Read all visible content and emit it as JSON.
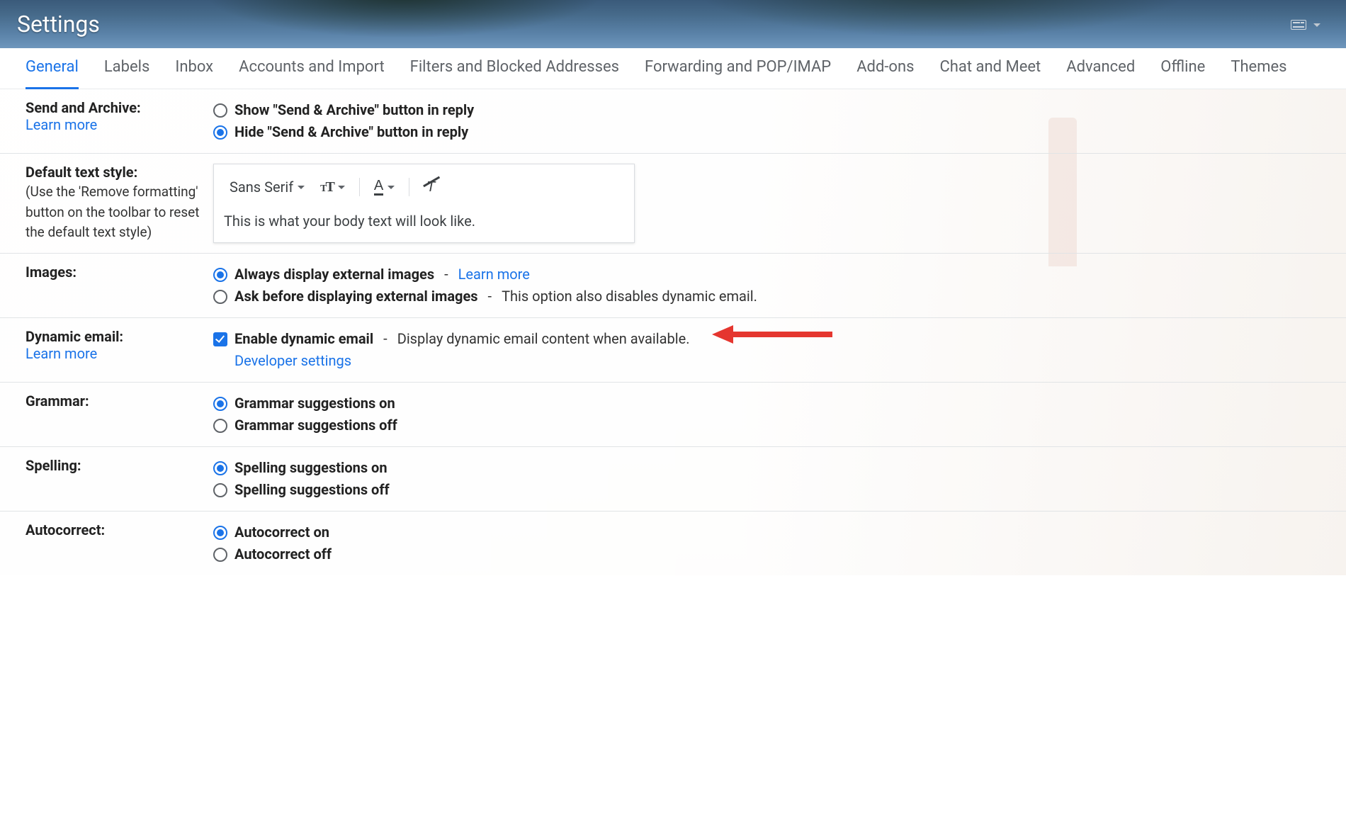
{
  "header": {
    "title": "Settings"
  },
  "tabs": [
    "General",
    "Labels",
    "Inbox",
    "Accounts and Import",
    "Filters and Blocked Addresses",
    "Forwarding and POP/IMAP",
    "Add-ons",
    "Chat and Meet",
    "Advanced",
    "Offline",
    "Themes"
  ],
  "active_tab": 0,
  "send_archive": {
    "title": "Send and Archive:",
    "learn_more": "Learn more",
    "show": "Show \"Send & Archive\" button in reply",
    "hide": "Hide \"Send & Archive\" button in reply",
    "selected": "hide"
  },
  "default_text_style": {
    "title": "Default text style:",
    "hint": "(Use the 'Remove formatting' button on the toolbar to reset the default text style)",
    "font_label": "Sans Serif",
    "preview": "This is what your body text will look like."
  },
  "images": {
    "title": "Images:",
    "always": "Always display external images",
    "learn_more": "Learn more",
    "ask": "Ask before displaying external images",
    "ask_note": "This option also disables dynamic email.",
    "selected": "always"
  },
  "dynamic_email": {
    "title": "Dynamic email:",
    "learn_more": "Learn more",
    "enable_label": "Enable dynamic email",
    "enable_note": "Display dynamic email content when available.",
    "dev_settings": "Developer settings",
    "enabled": true
  },
  "grammar": {
    "title": "Grammar:",
    "on": "Grammar suggestions on",
    "off": "Grammar suggestions off",
    "selected": "on"
  },
  "spelling": {
    "title": "Spelling:",
    "on": "Spelling suggestions on",
    "off": "Spelling suggestions off",
    "selected": "on"
  },
  "autocorrect": {
    "title": "Autocorrect:",
    "on": "Autocorrect on",
    "off": "Autocorrect off",
    "selected": "on"
  }
}
